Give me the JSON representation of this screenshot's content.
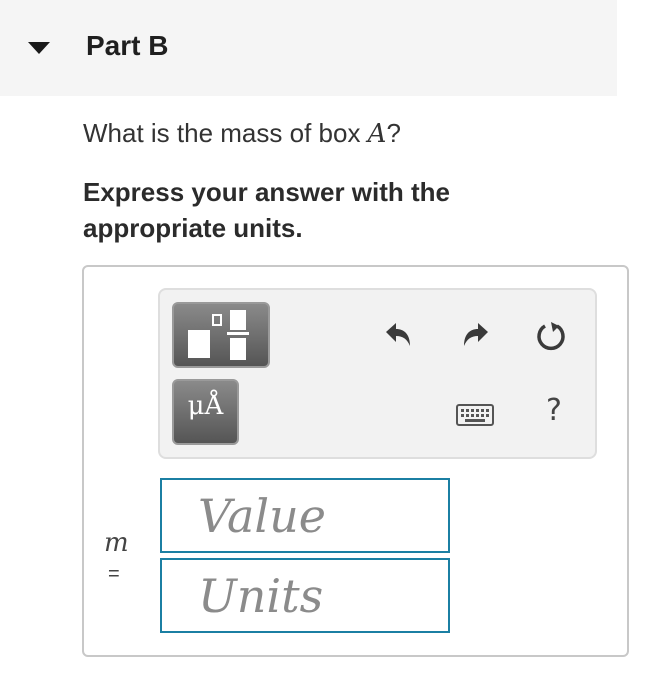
{
  "part": {
    "title": "Part B"
  },
  "question": {
    "prefix": "What is the mass of box ",
    "variable": "A",
    "suffix": "?"
  },
  "instruction": "Express your answer with the appropriate units.",
  "toolbar": {
    "units_label": "μÅ",
    "help_label": "?",
    "icons": [
      "templates-icon",
      "units-icon",
      "undo-icon",
      "redo-icon",
      "reset-icon",
      "keyboard-icon",
      "help-icon"
    ]
  },
  "answer": {
    "variable": "m",
    "equals": "=",
    "value_placeholder": "Value",
    "units_placeholder": "Units"
  },
  "colors": {
    "input_border": "#1b7fa3",
    "button_dark": "#555555"
  }
}
